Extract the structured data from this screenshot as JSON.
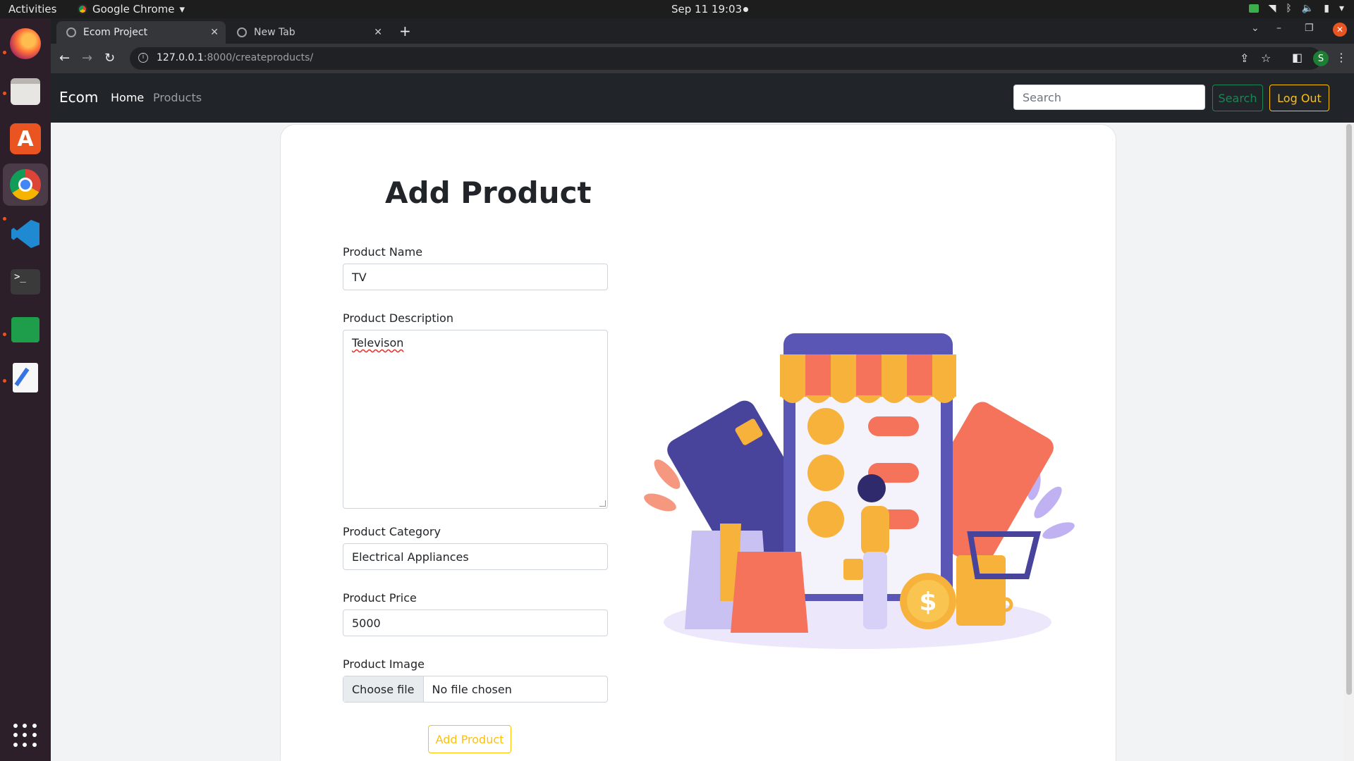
{
  "system": {
    "activities": "Activities",
    "app_name": "Google Chrome",
    "datetime": "Sep 11  19:03"
  },
  "browser": {
    "tabs": [
      {
        "title": "Ecom Project",
        "active": true
      },
      {
        "title": "New Tab",
        "active": false
      }
    ],
    "url_host": "127.0.0.1",
    "url_path": ":8000/createproducts/",
    "profile_initial": "S"
  },
  "navbar": {
    "brand": "Ecom",
    "links": [
      {
        "label": "Home",
        "active": true
      },
      {
        "label": "Products",
        "active": false
      }
    ],
    "search_placeholder": "Search",
    "search_button": "Search",
    "logout_button": "Log Out"
  },
  "form": {
    "title": "Add Product",
    "name_label": "Product Name",
    "name_value": "TV",
    "description_label": "Product Description",
    "description_value": "Televison",
    "category_label": "Product Category",
    "category_value": "Electrical Appliances",
    "price_label": "Product Price",
    "price_value": "5000",
    "image_label": "Product Image",
    "file_button": "Choose file",
    "file_status": "No file chosen",
    "submit_label": "Add Product"
  },
  "colors": {
    "navbar_bg": "#212529",
    "success": "#198754",
    "warning": "#ffc107",
    "dock_bg": "#2c1f2a",
    "ubuntu_orange": "#e95420"
  }
}
